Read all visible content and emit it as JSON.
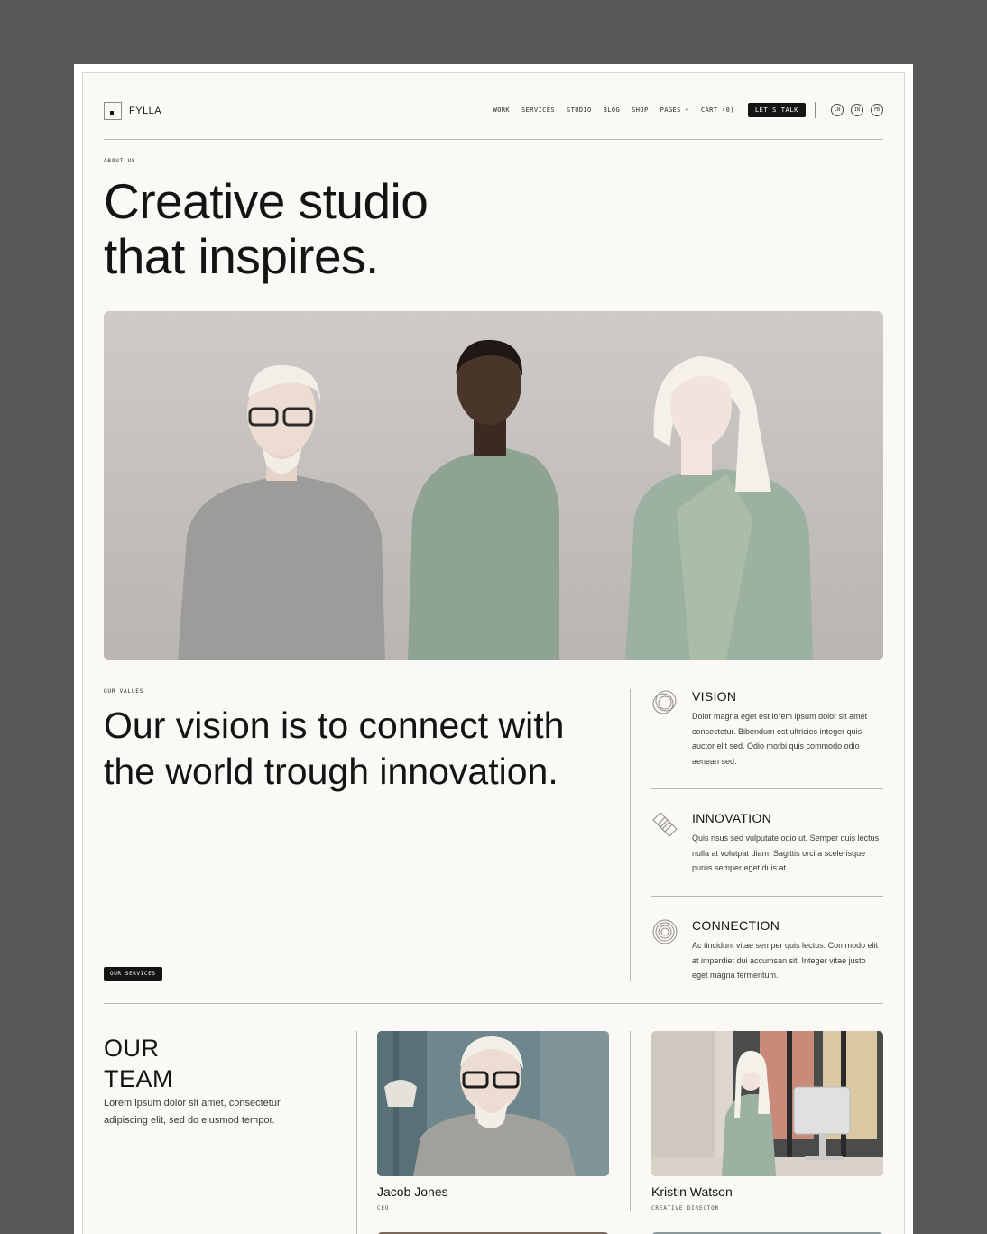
{
  "brand": {
    "name": "FYLLA"
  },
  "nav": {
    "items": [
      "WORK",
      "SERVICES",
      "STUDIO",
      "BLOG",
      "SHOP",
      "PAGES ▾",
      "CART (0)"
    ],
    "cta": "LET'S TALK",
    "social": [
      "LN",
      "IN",
      "FB"
    ]
  },
  "hero": {
    "eyebrow": "ABOUT US",
    "title_line1": "Creative studio",
    "title_line2": "that inspires."
  },
  "values": {
    "eyebrow": "OUR VALUES",
    "title": "Our vision is to connect with the world trough innovation.",
    "button": "OUR SERVICES",
    "items": [
      {
        "name": "VISION",
        "icon": "rings-icon",
        "text": "Dolor magna eget est lorem ipsum dolor sit amet consectetur. Bibendum est ultricies integer quis auctor elit sed. Odio morbi quis commodo odio aenean sed."
      },
      {
        "name": "INNOVATION",
        "icon": "layers-icon",
        "text": "Quis risus sed vulputate odio ut. Semper quis lectus nulla at volutpat diam. Sagittis orci a scelerisque purus semper eget duis at."
      },
      {
        "name": "CONNECTION",
        "icon": "concentric-circles-icon",
        "text": "Ac tincidunt vitae semper quis lectus. Commodo elit at imperdiet dui accumsan sit. Integer vitae justo eget magna fermentum."
      }
    ]
  },
  "team": {
    "title_line1": "OUR",
    "title_line2": "TEAM",
    "description": "Lorem ipsum dolor sit amet, consectetur adipiscing elit, sed do eiusmod tempor.",
    "members": [
      {
        "name": "Jacob Jones",
        "role": "CEO"
      },
      {
        "name": "Kristin Watson",
        "role": "CREATIVE DIRECTOR"
      }
    ]
  },
  "colors": {
    "page_bg": "#fbf9f5",
    "outer_bg": "#585858",
    "ink": "#141414",
    "sage": "#8fa294"
  }
}
